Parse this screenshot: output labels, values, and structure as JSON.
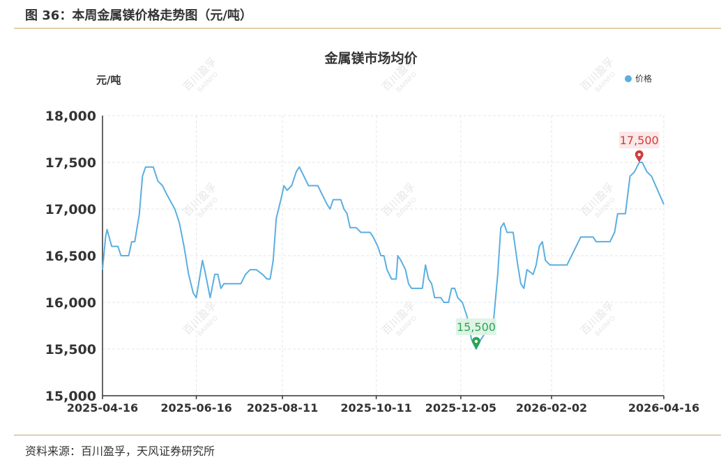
{
  "figure": {
    "title": "图 36：本周金属镁价格走势图（元/吨）",
    "source": "资料来源：百川盈孚，天风证券研究所"
  },
  "watermark": {
    "cn": "百川盈孚",
    "en": "BAIINFO"
  },
  "chart_data": {
    "type": "line",
    "title": "金属镁市场均价",
    "ylabel": "元/吨",
    "ylim": [
      15000,
      18000
    ],
    "yticks": [
      "15,000",
      "15,500",
      "16,000",
      "16,500",
      "17,000",
      "17,500",
      "18,000"
    ],
    "xticks": [
      "2025-04-16",
      "2025-06-16",
      "2025-08-11",
      "2025-10-11",
      "2025-12-05",
      "2026-02-02",
      "2026-04-16"
    ],
    "grid": true,
    "legend_position": "top-right",
    "series": [
      {
        "name": "价格",
        "color": "#5aaee0",
        "points": [
          [
            "2025-04-16",
            16350
          ],
          [
            "2025-04-18",
            16700
          ],
          [
            "2025-04-19",
            16780
          ],
          [
            "2025-04-22",
            16600
          ],
          [
            "2025-04-26",
            16600
          ],
          [
            "2025-04-28",
            16500
          ],
          [
            "2025-05-03",
            16500
          ],
          [
            "2025-05-05",
            16650
          ],
          [
            "2025-05-07",
            16650
          ],
          [
            "2025-05-10",
            16950
          ],
          [
            "2025-05-12",
            17350
          ],
          [
            "2025-05-14",
            17450
          ],
          [
            "2025-05-19",
            17450
          ],
          [
            "2025-05-22",
            17300
          ],
          [
            "2025-05-25",
            17250
          ],
          [
            "2025-05-28",
            17150
          ],
          [
            "2025-06-02",
            17000
          ],
          [
            "2025-06-05",
            16850
          ],
          [
            "2025-06-08",
            16600
          ],
          [
            "2025-06-11",
            16300
          ],
          [
            "2025-06-14",
            16100
          ],
          [
            "2025-06-16",
            16050
          ],
          [
            "2025-06-20",
            16450
          ],
          [
            "2025-06-22",
            16300
          ],
          [
            "2025-06-25",
            16050
          ],
          [
            "2025-06-28",
            16300
          ],
          [
            "2025-06-30",
            16300
          ],
          [
            "2025-07-02",
            16150
          ],
          [
            "2025-07-04",
            16200
          ],
          [
            "2025-07-15",
            16200
          ],
          [
            "2025-07-18",
            16300
          ],
          [
            "2025-07-21",
            16350
          ],
          [
            "2025-07-25",
            16350
          ],
          [
            "2025-07-29",
            16300
          ],
          [
            "2025-08-01",
            16250
          ],
          [
            "2025-08-03",
            16250
          ],
          [
            "2025-08-05",
            16450
          ],
          [
            "2025-08-07",
            16900
          ],
          [
            "2025-08-10",
            17100
          ],
          [
            "2025-08-12",
            17250
          ],
          [
            "2025-08-14",
            17200
          ],
          [
            "2025-08-17",
            17250
          ],
          [
            "2025-08-20",
            17400
          ],
          [
            "2025-08-22",
            17450
          ],
          [
            "2025-08-25",
            17350
          ],
          [
            "2025-08-28",
            17250
          ],
          [
            "2025-09-03",
            17250
          ],
          [
            "2025-09-06",
            17150
          ],
          [
            "2025-09-09",
            17050
          ],
          [
            "2025-09-11",
            17000
          ],
          [
            "2025-09-13",
            17100
          ],
          [
            "2025-09-18",
            17100
          ],
          [
            "2025-09-20",
            17000
          ],
          [
            "2025-09-22",
            16950
          ],
          [
            "2025-09-24",
            16800
          ],
          [
            "2025-09-28",
            16800
          ],
          [
            "2025-10-01",
            16750
          ],
          [
            "2025-10-07",
            16750
          ],
          [
            "2025-10-09",
            16700
          ],
          [
            "2025-10-12",
            16600
          ],
          [
            "2025-10-14",
            16500
          ],
          [
            "2025-10-16",
            16500
          ],
          [
            "2025-10-18",
            16350
          ],
          [
            "2025-10-21",
            16250
          ],
          [
            "2025-10-24",
            16250
          ],
          [
            "2025-10-25",
            16500
          ],
          [
            "2025-10-27",
            16450
          ],
          [
            "2025-10-30",
            16350
          ],
          [
            "2025-11-01",
            16200
          ],
          [
            "2025-11-03",
            16150
          ],
          [
            "2025-11-10",
            16150
          ],
          [
            "2025-11-12",
            16400
          ],
          [
            "2025-11-14",
            16250
          ],
          [
            "2025-11-16",
            16200
          ],
          [
            "2025-11-18",
            16050
          ],
          [
            "2025-11-22",
            16050
          ],
          [
            "2025-11-24",
            16000
          ],
          [
            "2025-11-27",
            16000
          ],
          [
            "2025-11-29",
            16150
          ],
          [
            "2025-12-01",
            16150
          ],
          [
            "2025-12-03",
            16050
          ],
          [
            "2025-12-06",
            16000
          ],
          [
            "2025-12-09",
            15850
          ],
          [
            "2025-12-12",
            15600
          ],
          [
            "2025-12-15",
            15500
          ],
          [
            "2025-12-18",
            15600
          ],
          [
            "2025-12-22",
            15700
          ],
          [
            "2025-12-26",
            15750
          ],
          [
            "2025-12-29",
            16300
          ],
          [
            "2025-12-31",
            16800
          ],
          [
            "2026-01-02",
            16850
          ],
          [
            "2026-01-04",
            16750
          ],
          [
            "2026-01-08",
            16750
          ],
          [
            "2026-01-11",
            16400
          ],
          [
            "2026-01-13",
            16200
          ],
          [
            "2026-01-15",
            16150
          ],
          [
            "2026-01-17",
            16350
          ],
          [
            "2026-01-21",
            16300
          ],
          [
            "2026-01-23",
            16400
          ],
          [
            "2026-01-25",
            16600
          ],
          [
            "2026-01-27",
            16650
          ],
          [
            "2026-01-29",
            16450
          ],
          [
            "2026-02-01",
            16400
          ],
          [
            "2026-02-05",
            16400
          ],
          [
            "2026-02-12",
            16400
          ],
          [
            "2026-02-15",
            16500
          ],
          [
            "2026-02-18",
            16600
          ],
          [
            "2026-02-21",
            16700
          ],
          [
            "2026-02-26",
            16700
          ],
          [
            "2026-03-01",
            16700
          ],
          [
            "2026-03-03",
            16650
          ],
          [
            "2026-03-12",
            16650
          ],
          [
            "2026-03-15",
            16750
          ],
          [
            "2026-03-17",
            16950
          ],
          [
            "2026-03-22",
            16950
          ],
          [
            "2026-03-25",
            17350
          ],
          [
            "2026-03-28",
            17400
          ],
          [
            "2026-03-31",
            17500
          ],
          [
            "2026-04-02",
            17500
          ],
          [
            "2026-04-05",
            17400
          ],
          [
            "2026-04-08",
            17350
          ],
          [
            "2026-04-12",
            17200
          ],
          [
            "2026-04-16",
            17050
          ]
        ]
      }
    ],
    "annotations": [
      {
        "kind": "max",
        "x": "2026-03-31",
        "value": 17500,
        "label": "17,500",
        "color": "#d23c3c"
      },
      {
        "kind": "min",
        "x": "2025-12-15",
        "value": 15500,
        "label": "15,500",
        "color": "#2aa552"
      }
    ]
  }
}
